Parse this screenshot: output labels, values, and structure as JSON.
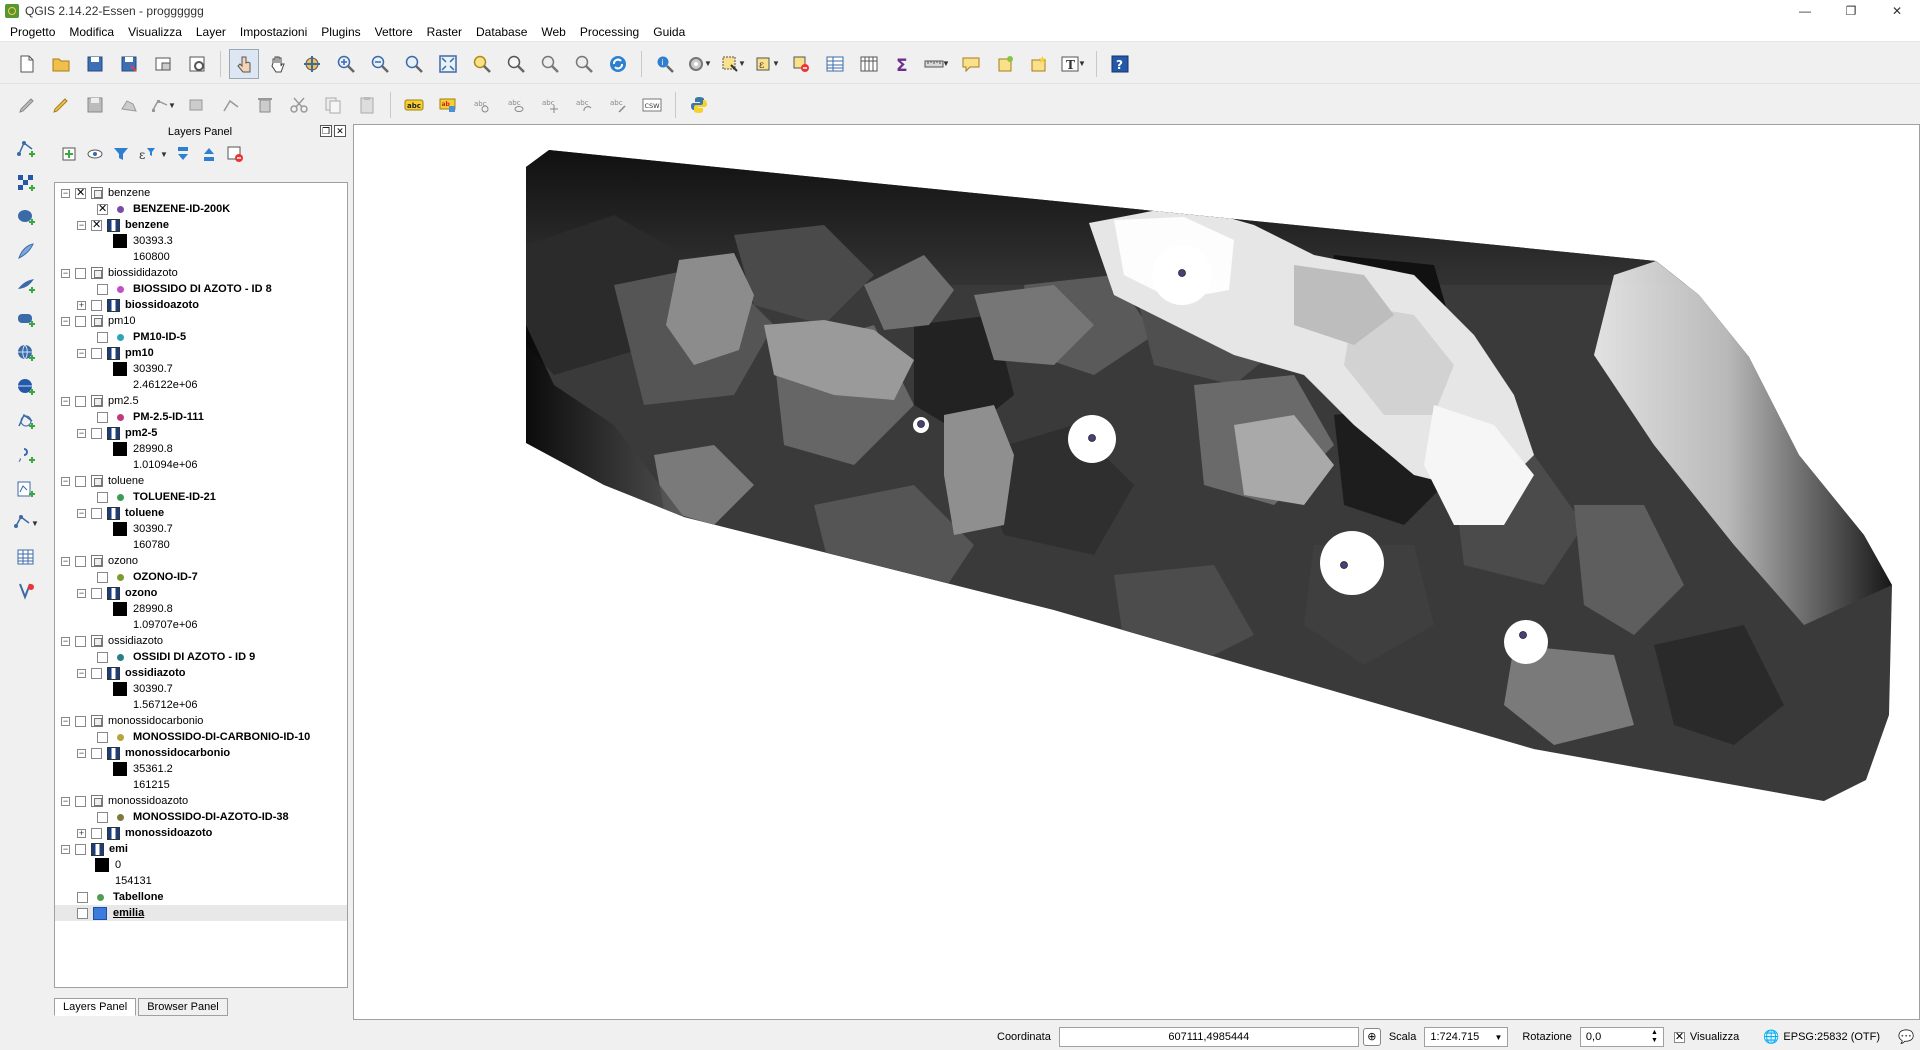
{
  "window": {
    "title": "QGIS 2.14.22-Essen - progggggg",
    "minimize": "—",
    "restore": "❐",
    "close": "✕"
  },
  "menu": [
    "Progetto",
    "Modifica",
    "Visualizza",
    "Layer",
    "Impostazioni",
    "Plugins",
    "Vettore",
    "Raster",
    "Database",
    "Web",
    "Processing",
    "Guida"
  ],
  "layers_panel": {
    "title": "Layers Panel",
    "tabs": [
      "Layers Panel",
      "Browser Panel"
    ],
    "active_tab": "Layers Panel"
  },
  "tree": [
    {
      "type": "group",
      "label": "benzene",
      "expanded": true,
      "checked": true
    },
    {
      "type": "point",
      "label": "BENZENE-ID-200K",
      "checked": true,
      "color": "#7b4aa8"
    },
    {
      "type": "raster",
      "label": "benzene",
      "expanded": true,
      "checked": true
    },
    {
      "type": "legend",
      "label": "30393.3"
    },
    {
      "type": "legend-text",
      "label": "160800"
    },
    {
      "type": "group",
      "label": "biossididazoto",
      "expanded": true,
      "checked": false
    },
    {
      "type": "point",
      "label": "BIOSSIDO DI AZOTO - ID 8",
      "checked": false,
      "color": "#c44fc4"
    },
    {
      "type": "raster",
      "label": "biossidoazoto",
      "expanded": false,
      "checked": false
    },
    {
      "type": "group",
      "label": "pm10",
      "expanded": true,
      "checked": false
    },
    {
      "type": "point",
      "label": "PM10-ID-5",
      "checked": false,
      "color": "#2aa6b8"
    },
    {
      "type": "raster",
      "label": "pm10",
      "expanded": true,
      "checked": false
    },
    {
      "type": "legend",
      "label": "30390.7"
    },
    {
      "type": "legend-text",
      "label": "2.46122e+06"
    },
    {
      "type": "group",
      "label": "pm2.5",
      "expanded": true,
      "checked": false
    },
    {
      "type": "point",
      "label": "PM-2.5-ID-111",
      "checked": false,
      "color": "#c2397a"
    },
    {
      "type": "raster",
      "label": "pm2-5",
      "expanded": true,
      "checked": false
    },
    {
      "type": "legend",
      "label": "28990.8"
    },
    {
      "type": "legend-text",
      "label": "1.01094e+06"
    },
    {
      "type": "group",
      "label": "toluene",
      "expanded": true,
      "checked": false
    },
    {
      "type": "point",
      "label": "TOLUENE-ID-21",
      "checked": false,
      "color": "#3f9b53"
    },
    {
      "type": "raster",
      "label": "toluene",
      "expanded": true,
      "checked": false
    },
    {
      "type": "legend",
      "label": "30390.7"
    },
    {
      "type": "legend-text",
      "label": "160780"
    },
    {
      "type": "group",
      "label": "ozono",
      "expanded": true,
      "checked": false
    },
    {
      "type": "point",
      "label": "OZONO-ID-7",
      "checked": false,
      "color": "#7a9b2e"
    },
    {
      "type": "raster",
      "label": "ozono",
      "expanded": true,
      "checked": false
    },
    {
      "type": "legend",
      "label": "28990.8"
    },
    {
      "type": "legend-text",
      "label": "1.09707e+06"
    },
    {
      "type": "group",
      "label": "ossidiazoto",
      "expanded": true,
      "checked": false
    },
    {
      "type": "point",
      "label": "OSSIDI DI AZOTO - ID 9",
      "checked": false,
      "color": "#2a7f86"
    },
    {
      "type": "raster",
      "label": "ossidiazoto",
      "expanded": true,
      "checked": false
    },
    {
      "type": "legend",
      "label": "30390.7"
    },
    {
      "type": "legend-text",
      "label": "1.56712e+06"
    },
    {
      "type": "group",
      "label": "monossidocarbonio",
      "expanded": true,
      "checked": false
    },
    {
      "type": "point",
      "label": "MONOSSIDO-DI-CARBONIO-ID-10",
      "checked": false,
      "color": "#b8a23a"
    },
    {
      "type": "raster",
      "label": "monossidocarbonio",
      "expanded": true,
      "checked": false
    },
    {
      "type": "legend",
      "label": "35361.2"
    },
    {
      "type": "legend-text",
      "label": "161215"
    },
    {
      "type": "group",
      "label": "monossidoazoto",
      "expanded": true,
      "checked": false
    },
    {
      "type": "point",
      "label": "MONOSSIDO-DI-AZOTO-ID-38",
      "checked": false,
      "color": "#7d7a3a"
    },
    {
      "type": "raster",
      "label": "monossidoazoto",
      "expanded": false,
      "checked": false
    },
    {
      "type": "raster-top",
      "label": "emi",
      "expanded": true,
      "checked": false
    },
    {
      "type": "legend-top",
      "label": "0"
    },
    {
      "type": "legend-text-top",
      "label": "154131"
    },
    {
      "type": "point-top",
      "label": "Tabellone",
      "checked": false,
      "color": "#4f9e4f"
    },
    {
      "type": "polygon-top",
      "label": "emilia",
      "checked": false,
      "color": "#3b7bde",
      "selected": true
    }
  ],
  "statusbar": {
    "coord_label": "Coordinata",
    "coord_value": "607111,4985444",
    "scale_label": "Scala",
    "scale_value": "1:724.715",
    "rotation_label": "Rotazione",
    "rotation_value": "0,0",
    "render_label": "Visualizza",
    "crs": "EPSG:25832 (OTF)"
  },
  "map": {
    "stations": 5,
    "point_color": "#4b3f7a"
  }
}
